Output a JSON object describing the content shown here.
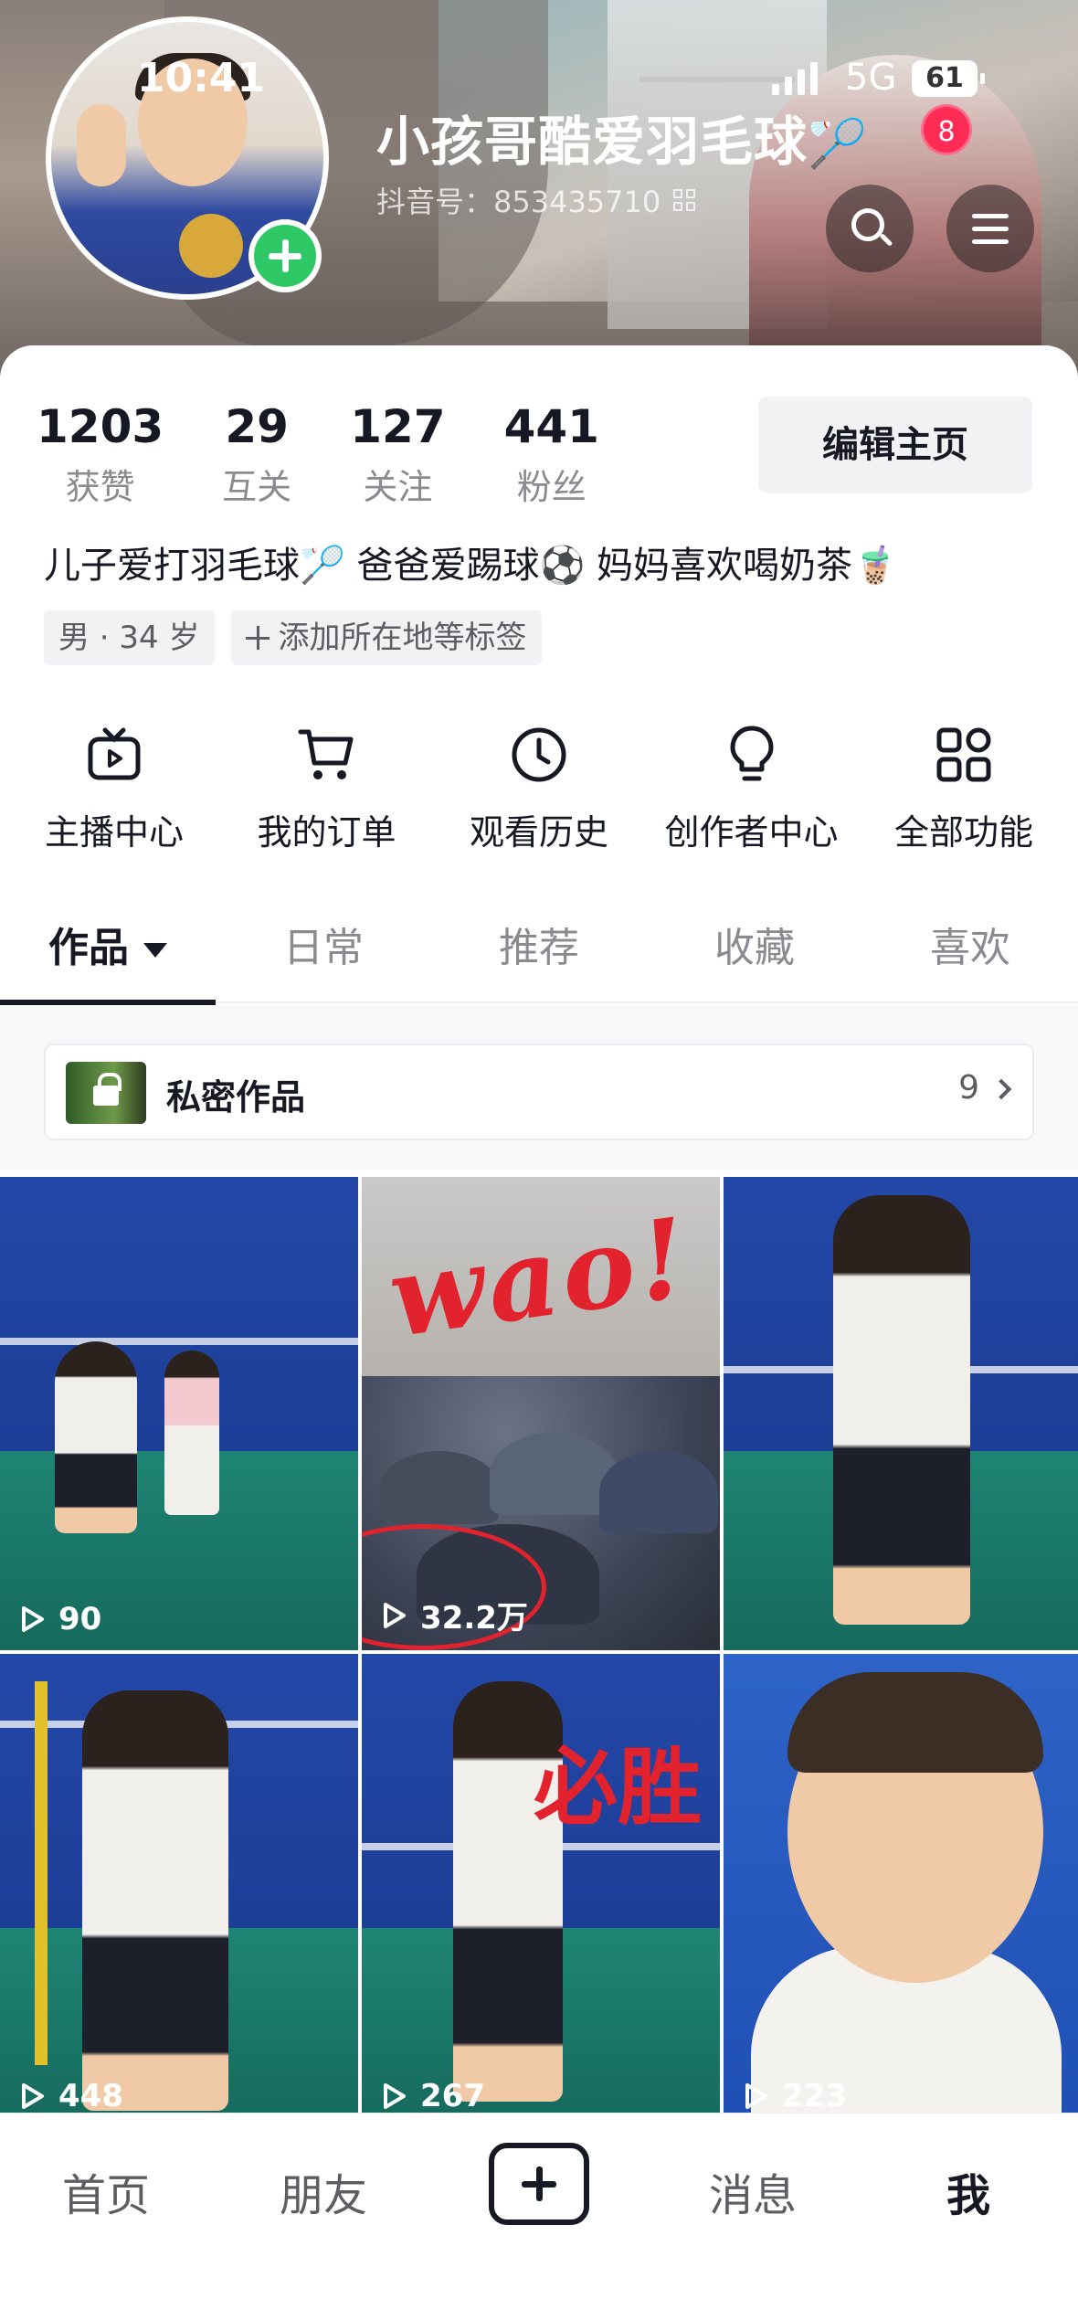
{
  "status_bar": {
    "time": "10:41",
    "network": "5G",
    "battery": "61"
  },
  "profile": {
    "nickname": "小孩哥酷爱羽毛球",
    "nickname_emoji": "🏸",
    "douyin_id": "抖音号：853435710",
    "notification_count": "8",
    "stats": [
      {
        "num": "1203",
        "label": "获赞"
      },
      {
        "num": "29",
        "label": "互关"
      },
      {
        "num": "127",
        "label": "关注"
      },
      {
        "num": "441",
        "label": "粉丝"
      }
    ],
    "edit_button": "编辑主页",
    "bio": "儿子爱打羽毛球🏸 爸爸爱踢球⚽ 妈妈喜欢喝奶茶🧋",
    "tag_gender_age": "男 · 34 岁",
    "tag_add": "添加所在地等标签"
  },
  "functions": [
    {
      "label": "主播中心",
      "icon": "tv-icon"
    },
    {
      "label": "我的订单",
      "icon": "cart-icon"
    },
    {
      "label": "观看历史",
      "icon": "clock-icon"
    },
    {
      "label": "创作者中心",
      "icon": "bulb-icon"
    },
    {
      "label": "全部功能",
      "icon": "grid-icon"
    }
  ],
  "tabs": [
    {
      "label": "作品",
      "active": true
    },
    {
      "label": "日常"
    },
    {
      "label": "推荐"
    },
    {
      "label": "收藏"
    },
    {
      "label": "喜欢"
    }
  ],
  "private_works": {
    "label": "私密作品",
    "count": "9"
  },
  "videos": [
    {
      "plays": "90"
    },
    {
      "plays": "32.2万",
      "overlay_text": "wao!"
    },
    {
      "plays": ""
    },
    {
      "plays": "448"
    },
    {
      "plays": "267",
      "overlay_text": "必胜"
    },
    {
      "plays": "223"
    }
  ],
  "bottom_nav": [
    {
      "label": "首页"
    },
    {
      "label": "朋友"
    },
    {
      "label": "消息"
    },
    {
      "label": "我",
      "active": true
    }
  ],
  "colors": {
    "accent_red": "#fe2c55",
    "add_green": "#2ec866",
    "text_primary": "#161823",
    "text_secondary": "#8a8b91"
  }
}
